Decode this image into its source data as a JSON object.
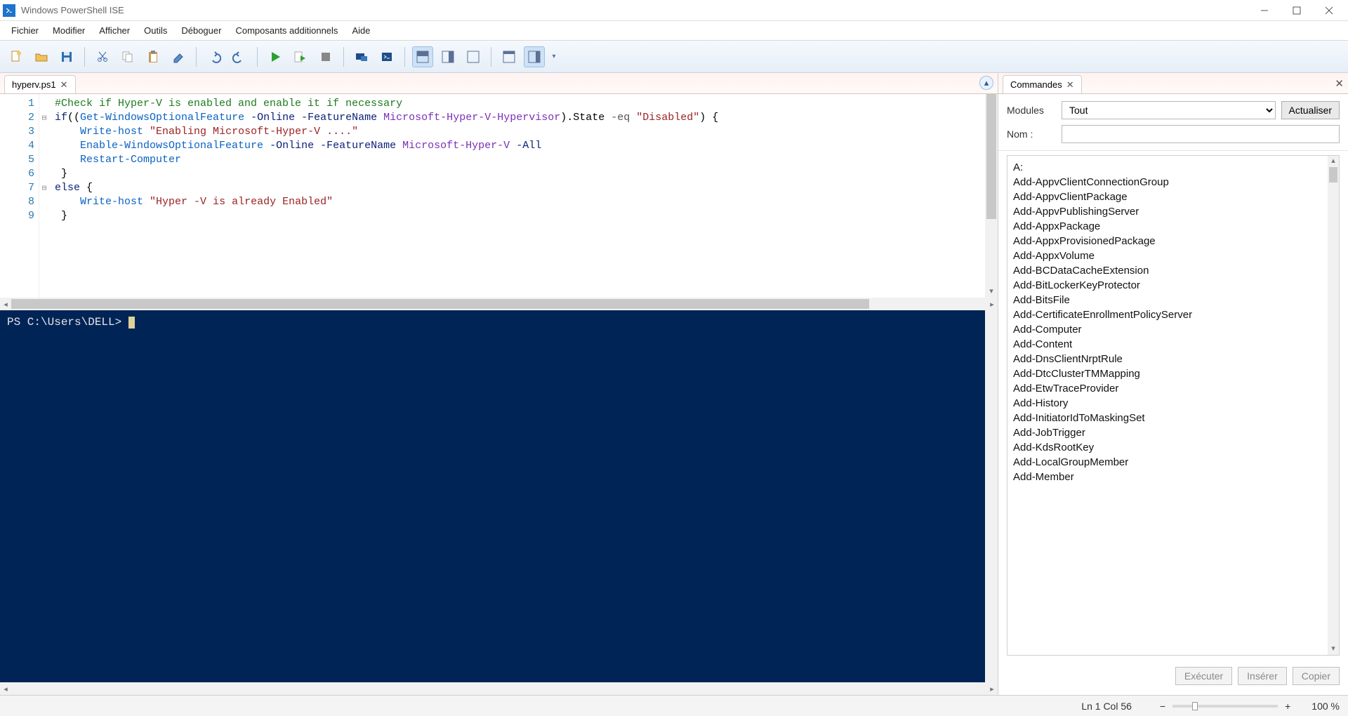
{
  "window": {
    "title": "Windows PowerShell ISE"
  },
  "menus": [
    "Fichier",
    "Modifier",
    "Afficher",
    "Outils",
    "Déboguer",
    "Composants additionnels",
    "Aide"
  ],
  "toolbar_icons": [
    "new-file-icon",
    "open-file-icon",
    "save-icon",
    "cut-icon",
    "copy-icon",
    "paste-icon",
    "clear-icon",
    "undo-icon",
    "redo-icon",
    "run-icon",
    "run-selection-icon",
    "stop-icon",
    "remote-pshost-icon",
    "new-pshost-icon",
    "layout-script-top-icon",
    "layout-script-right-icon",
    "layout-script-max-icon",
    "toggle-tool-window-icon",
    "toggle-command-addon-icon"
  ],
  "tabs": [
    {
      "label": "hyperv.ps1"
    }
  ],
  "code_lines": [
    {
      "n": 1,
      "fold": "",
      "segs": [
        {
          "c": "c-comment",
          "t": "#Check if Hyper-V is enabled and enable it if necessary"
        }
      ]
    },
    {
      "n": 2,
      "fold": "⊟",
      "segs": [
        {
          "c": "c-key",
          "t": "if"
        },
        {
          "c": "",
          "t": "(("
        },
        {
          "c": "c-cmd",
          "t": "Get-WindowsOptionalFeature"
        },
        {
          "c": "",
          "t": " "
        },
        {
          "c": "c-param",
          "t": "-Online"
        },
        {
          "c": "",
          "t": " "
        },
        {
          "c": "c-param",
          "t": "-FeatureName"
        },
        {
          "c": "",
          "t": " "
        },
        {
          "c": "c-type",
          "t": "Microsoft-Hyper-V-Hypervisor"
        },
        {
          "c": "",
          "t": ")."
        },
        {
          "c": "",
          "t": "State "
        },
        {
          "c": "c-op",
          "t": "-eq"
        },
        {
          "c": "",
          "t": " "
        },
        {
          "c": "c-str",
          "t": "\"Disabled\""
        },
        {
          "c": "",
          "t": ") {"
        }
      ]
    },
    {
      "n": 3,
      "fold": "",
      "segs": [
        {
          "c": "",
          "t": "    "
        },
        {
          "c": "c-cmd",
          "t": "Write-host"
        },
        {
          "c": "",
          "t": " "
        },
        {
          "c": "c-str",
          "t": "\"Enabling Microsoft-Hyper-V ....\""
        }
      ]
    },
    {
      "n": 4,
      "fold": "",
      "segs": [
        {
          "c": "",
          "t": "    "
        },
        {
          "c": "c-cmd",
          "t": "Enable-WindowsOptionalFeature"
        },
        {
          "c": "",
          "t": " "
        },
        {
          "c": "c-param",
          "t": "-Online"
        },
        {
          "c": "",
          "t": " "
        },
        {
          "c": "c-param",
          "t": "-FeatureName"
        },
        {
          "c": "",
          "t": " "
        },
        {
          "c": "c-type",
          "t": "Microsoft-Hyper-V"
        },
        {
          "c": "",
          "t": " "
        },
        {
          "c": "c-param",
          "t": "-All"
        }
      ]
    },
    {
      "n": 5,
      "fold": "",
      "segs": [
        {
          "c": "",
          "t": "    "
        },
        {
          "c": "c-cmd",
          "t": "Restart-Computer"
        }
      ]
    },
    {
      "n": 6,
      "fold": "",
      "segs": [
        {
          "c": "",
          "t": " }"
        }
      ]
    },
    {
      "n": 7,
      "fold": "⊟",
      "segs": [
        {
          "c": "c-key",
          "t": "else"
        },
        {
          "c": "",
          "t": " {"
        }
      ]
    },
    {
      "n": 8,
      "fold": "",
      "segs": [
        {
          "c": "",
          "t": "    "
        },
        {
          "c": "c-cmd",
          "t": "Write-host"
        },
        {
          "c": "",
          "t": " "
        },
        {
          "c": "c-str",
          "t": "\"Hyper -V is already Enabled\""
        }
      ]
    },
    {
      "n": 9,
      "fold": "",
      "segs": [
        {
          "c": "",
          "t": " }"
        }
      ]
    }
  ],
  "console": {
    "prompt": "PS C:\\Users\\DELL> "
  },
  "commands_panel": {
    "tab_label": "Commandes",
    "modules_label": "Modules",
    "modules_value": "Tout",
    "refresh_label": "Actualiser",
    "name_label": "Nom :",
    "name_value": "",
    "list": [
      "A:",
      "Add-AppvClientConnectionGroup",
      "Add-AppvClientPackage",
      "Add-AppvPublishingServer",
      "Add-AppxPackage",
      "Add-AppxProvisionedPackage",
      "Add-AppxVolume",
      "Add-BCDataCacheExtension",
      "Add-BitLockerKeyProtector",
      "Add-BitsFile",
      "Add-CertificateEnrollmentPolicyServer",
      "Add-Computer",
      "Add-Content",
      "Add-DnsClientNrptRule",
      "Add-DtcClusterTMMapping",
      "Add-EtwTraceProvider",
      "Add-History",
      "Add-InitiatorIdToMaskingSet",
      "Add-JobTrigger",
      "Add-KdsRootKey",
      "Add-LocalGroupMember",
      "Add-Member"
    ],
    "buttons": {
      "run": "Exécuter",
      "insert": "Insérer",
      "copy": "Copier"
    }
  },
  "status": {
    "lncol": "Ln 1  Col 56",
    "zoom": "100 %"
  }
}
